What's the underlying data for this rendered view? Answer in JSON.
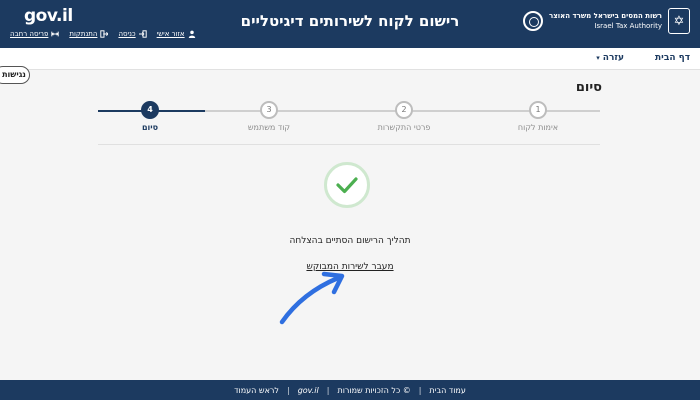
{
  "header": {
    "logo_text": "gov.il",
    "title": "רישום לקוח לשירותים דיגיטליים",
    "authority_hebrew": "רשות המסים בישראל משרד האוצר",
    "authority_english": "Israel Tax Authority",
    "top_links": [
      {
        "label": "אזור אישי",
        "icon": "person-icon"
      },
      {
        "label": "כניסה",
        "icon": "login-icon"
      },
      {
        "label": "התנתקות",
        "icon": "logout-icon"
      },
      {
        "label": "פריסה רחבה",
        "icon": "wide-layout-icon"
      }
    ]
  },
  "subnav": {
    "home_label": "דף הבית",
    "help_label": "עזרה"
  },
  "accessibility_label": "נגישות",
  "page_title": "סיום",
  "steps": [
    {
      "number": "1",
      "label": "אימות לקוח"
    },
    {
      "number": "2",
      "label": "פרטי התקשרות"
    },
    {
      "number": "3",
      "label": "קוד משתמש"
    },
    {
      "number": "4",
      "label": "סיום"
    }
  ],
  "active_step": 4,
  "success": {
    "message": "תהליך הרישום הסתיים בהצלחה",
    "link_label": "מעבר לשירות המבוקש"
  },
  "footer": {
    "links": [
      "עמוד הבית",
      "© כל הזכויות שמורות",
      "gov.il",
      "לראש העמוד"
    ]
  },
  "colors": {
    "brand_navy": "#1c3a60",
    "success_green": "#4caf50",
    "annotation_arrow": "#2f6fe0"
  }
}
